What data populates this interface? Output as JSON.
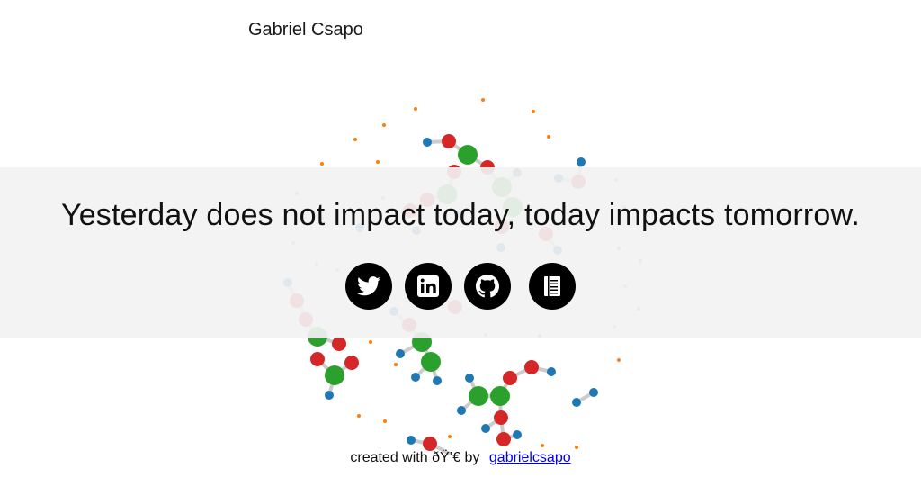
{
  "header": {
    "site_name": "Gabriel Csapo"
  },
  "hero": {
    "tagline": "Yesterday does not impact today, today impacts tomorrow."
  },
  "social": [
    {
      "name": "twitter",
      "icon": "twitter-icon"
    },
    {
      "name": "linkedin",
      "icon": "linkedin-icon"
    },
    {
      "name": "github",
      "icon": "github-icon"
    },
    {
      "name": "blog",
      "icon": "book-icon"
    }
  ],
  "footer": {
    "prefix": "created with ðŸ’€ by",
    "link_text": "gabrielcsapo"
  },
  "colors": {
    "atom_red": "#d62728",
    "atom_green": "#2ca02c",
    "atom_blue": "#1f77b4",
    "atom_orange": "#ff7f0e",
    "bond": "#cccccc",
    "band": "#f2f2f2"
  }
}
